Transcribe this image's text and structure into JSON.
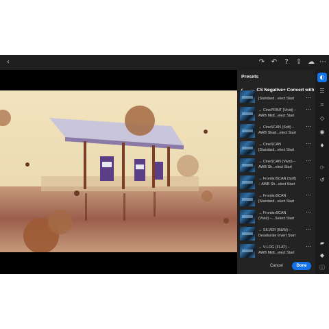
{
  "toolbar": {
    "back_icon": "chevron-left-icon",
    "icons": [
      "redo-icon",
      "undo-icon",
      "help-icon",
      "share-icon",
      "cloud-sync-icon",
      "more-icon"
    ]
  },
  "panel": {
    "title": "Presets",
    "breadcrumb": "→ CS Negative+ Convert with...",
    "presets": [
      {
        "line1": "[Standard...elect Start",
        "line2": ""
      },
      {
        "line1": "→ CinePRINT (Vivid) –",
        "line2": "AWB Midt...elect Start"
      },
      {
        "line1": "→ CineSCAN (Soft) –",
        "line2": "AWB Shad...elect Start"
      },
      {
        "line1": "→ CineSCAN",
        "line2": "[Standard...elect Start"
      },
      {
        "line1": "→ CineSCAN (Vivid) –",
        "line2": "AWB Sh...elect Start"
      },
      {
        "line1": "→ FrontierSCAN (Soft)",
        "line2": "– AWB Sh...elect Start"
      },
      {
        "line1": "→ FrontierSCAN",
        "line2": "[Standard...elect Start"
      },
      {
        "line1": "→ FrontierSCAN",
        "line2": "(Vivid) –...Select Start"
      },
      {
        "line1": "→ SILVER (B&W) –",
        "line2": "Desaturate Invert Start"
      },
      {
        "line1": "→ V-LOG (FLAT) –",
        "line2": "AWB Midt...elect Start"
      }
    ],
    "cancel_label": "Cancel",
    "done_label": "Done"
  },
  "rail": {
    "icons": [
      "presets-icon",
      "sliders-icon",
      "crop-icon",
      "eraser-icon",
      "circle-mask-icon",
      "color-drop-icon",
      "versions-icon",
      "history-icon",
      "comment-icon",
      "tag-icon",
      "info-icon"
    ]
  },
  "colors": {
    "accent": "#1473e6",
    "panel_bg": "#232323",
    "app_bg": "#1a1a1a"
  }
}
